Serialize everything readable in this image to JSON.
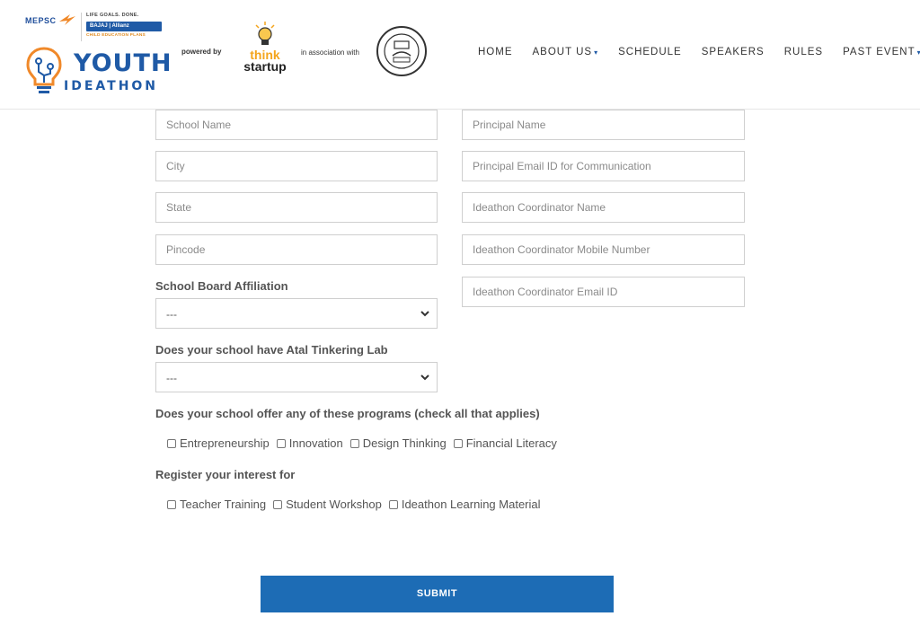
{
  "header": {
    "brand": {
      "mepsc": "MEPSC",
      "life_goals": "LIFE GOALS. DONE.",
      "bajaj": "BAJAJ | Allianz",
      "child_plans": "CHILD EDUCATION PLANS",
      "youth": "YOUTH",
      "ideathon": "IDEATHON"
    },
    "powered_by": "powered by",
    "think": "think",
    "startup": "startup",
    "in_association_with": "in association with",
    "nav": [
      {
        "label": "HOME",
        "dropdown": false
      },
      {
        "label": "ABOUT US",
        "dropdown": true
      },
      {
        "label": "SCHEDULE",
        "dropdown": false
      },
      {
        "label": "SPEAKERS",
        "dropdown": false
      },
      {
        "label": "RULES",
        "dropdown": false
      },
      {
        "label": "PAST EVENT",
        "dropdown": true
      }
    ]
  },
  "form": {
    "left_fields": [
      {
        "placeholder": "School Name"
      },
      {
        "placeholder": "City"
      },
      {
        "placeholder": "State"
      },
      {
        "placeholder": "Pincode"
      }
    ],
    "right_fields": [
      {
        "placeholder": "Principal Name"
      },
      {
        "placeholder": "Principal Email ID for Communication"
      },
      {
        "placeholder": "Ideathon Coordinator Name"
      },
      {
        "placeholder": "Ideathon Coordinator Mobile Number"
      },
      {
        "placeholder": "Ideathon Coordinator Email ID"
      }
    ],
    "board_label": "School Board Affiliation",
    "board_value": "---",
    "atl_label": "Does your school have Atal Tinkering Lab",
    "atl_value": "---",
    "programs_label": "Does your school offer any of these programs (check all that applies)",
    "programs": [
      "Entrepreneurship",
      "Innovation",
      "Design Thinking",
      "Financial Literacy"
    ],
    "interest_label": "Register your interest for",
    "interests": [
      "Teacher Training",
      "Student Workshop",
      "Ideathon Learning Material"
    ],
    "submit": "SUBMIT"
  },
  "colors": {
    "brand_blue": "#1f5aa6",
    "submit_blue": "#1d6cb5",
    "accent_orange": "#f4a51c"
  }
}
